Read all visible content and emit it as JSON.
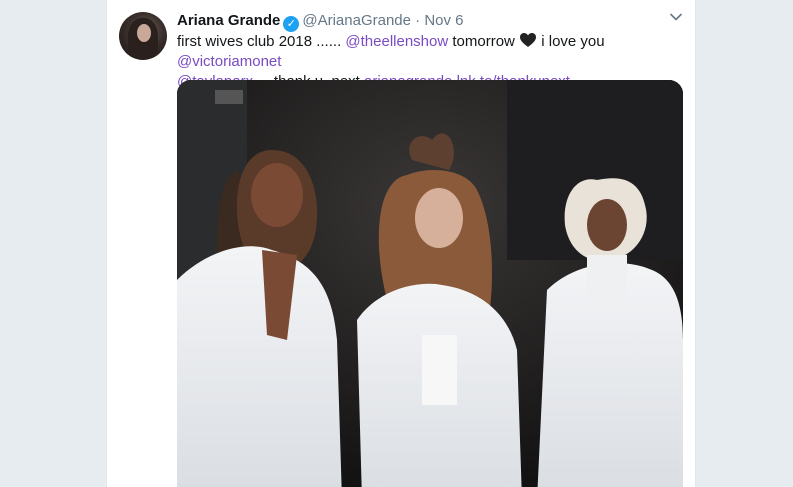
{
  "tweet": {
    "author_name": "Ariana Grande",
    "handle": "@ArianaGrande",
    "separator": "·",
    "date": "Nov 6",
    "text": {
      "part1": "first wives club 2018 ......",
      "mention1": "@theellenshow",
      "part2": "tomorrow",
      "part3": "i love you",
      "mention2": "@victoriamonet",
      "mention3": "@taylaparx",
      "part4": "... thank u, next",
      "link": "arianagrande.lnk.to/thankunext"
    }
  },
  "icons": {
    "verified": "verified-badge-icon",
    "heart": "black-heart-icon",
    "menu": "chevron-down-icon"
  },
  "colors": {
    "link": "#794bc4",
    "verified": "#1da1f2",
    "background": "#e6ecf0"
  }
}
